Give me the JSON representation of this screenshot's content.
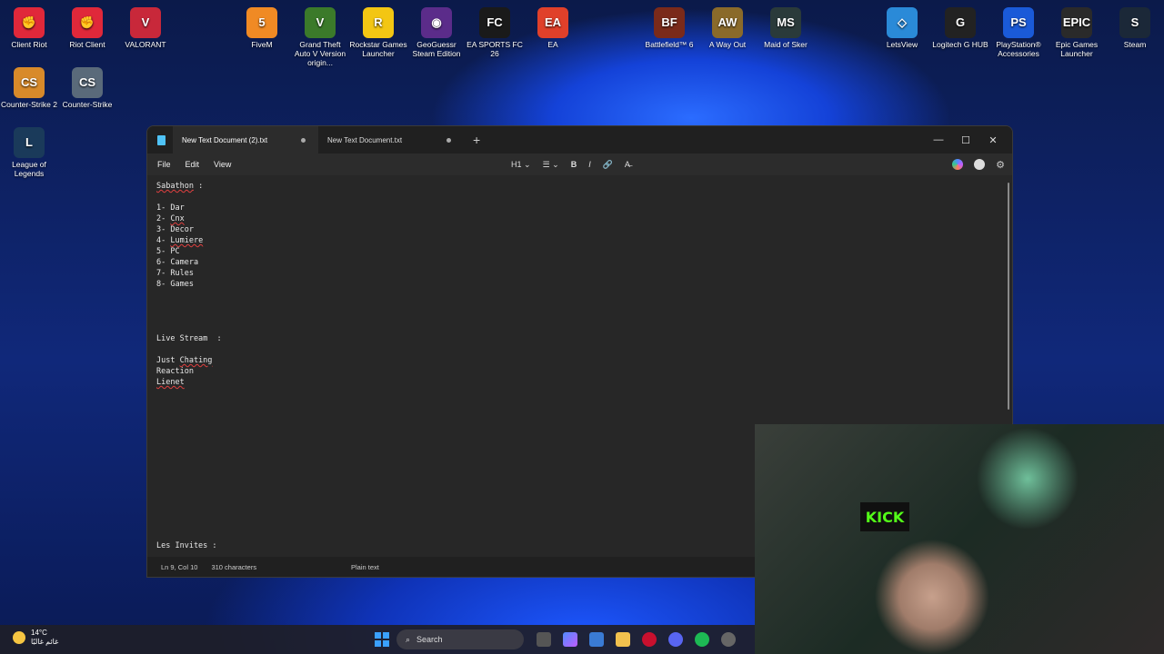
{
  "desktop": {
    "icons": [
      {
        "label": "Client Riot",
        "color": "#e0283a",
        "glyph": "✊"
      },
      {
        "label": "Riot Client",
        "color": "#e0283a",
        "glyph": "✊"
      },
      {
        "label": "VALORANT",
        "color": "#c8283a",
        "glyph": "V"
      },
      {
        "label": "FiveM",
        "color": "#f08a24",
        "glyph": "5"
      },
      {
        "label": "Grand Theft Auto V Version origin...",
        "color": "#3b7a2a",
        "glyph": "V"
      },
      {
        "label": "Rockstar Games Launcher",
        "color": "#f3c613",
        "glyph": "R"
      },
      {
        "label": "GeoGuessr Steam Edition",
        "color": "#5b2c8a",
        "glyph": "◉"
      },
      {
        "label": "EA SPORTS FC 26",
        "color": "#1a1a1a",
        "glyph": "FC"
      },
      {
        "label": "EA",
        "color": "#e0402a",
        "glyph": "EA"
      },
      {
        "label": "Battlefield™ 6",
        "color": "#7a2a1a",
        "glyph": "BF"
      },
      {
        "label": "A Way Out",
        "color": "#8a6a2a",
        "glyph": "AW"
      },
      {
        "label": "Maid of Sker",
        "color": "#2a3a3a",
        "glyph": "MS"
      },
      {
        "label": "LetsView",
        "color": "#2a8ad8",
        "glyph": "◇"
      },
      {
        "label": "Logitech G HUB",
        "color": "#222222",
        "glyph": "G"
      },
      {
        "label": "PlayStation® Accessories",
        "color": "#1a5ad8",
        "glyph": "PS"
      },
      {
        "label": "Epic Games Launcher",
        "color": "#2a2a2a",
        "glyph": "EPIC"
      },
      {
        "label": "Steam",
        "color": "#1b2838",
        "glyph": "S"
      },
      {
        "label": "Counter-Strike 2",
        "color": "#d88a2a",
        "glyph": "CS"
      },
      {
        "label": "Counter-Strike",
        "color": "#5a6a7a",
        "glyph": "CS"
      },
      {
        "label": "League of Legends",
        "color": "#1a3a5a",
        "glyph": "L"
      }
    ]
  },
  "notepad": {
    "tabs": [
      {
        "label": "New Text Document (2).txt"
      },
      {
        "label": "New Text Document.txt"
      }
    ],
    "new_tab": "+",
    "controls": {
      "minimize": "—",
      "maximize": "☐",
      "close": "✕"
    },
    "menu": [
      "File",
      "Edit",
      "View"
    ],
    "format": {
      "heading": "H1",
      "list": "☰",
      "bold": "B",
      "italic": "I",
      "link": "🔗",
      "clear": "A̶"
    },
    "lines": [
      "Sabathon :",
      "",
      "1- Dar",
      "2- Cnx",
      "3- Decor",
      "4- Lumiere",
      "5- PC",
      "6- Camera",
      "7- Rules",
      "8- Games",
      "",
      "",
      "",
      "",
      "Live Stream  :",
      "",
      "Just Chating",
      "Reaction",
      "Lienet"
    ],
    "footer_line": "Les Invites :",
    "status": {
      "position": "Ln 9, Col 10",
      "characters": "310 characters",
      "type": "Plain text"
    }
  },
  "webcam": {
    "sign": "KICK"
  },
  "taskbar": {
    "temperature": "14°C",
    "weather_text": "غائم غالبًا",
    "search_placeholder": "Search"
  }
}
